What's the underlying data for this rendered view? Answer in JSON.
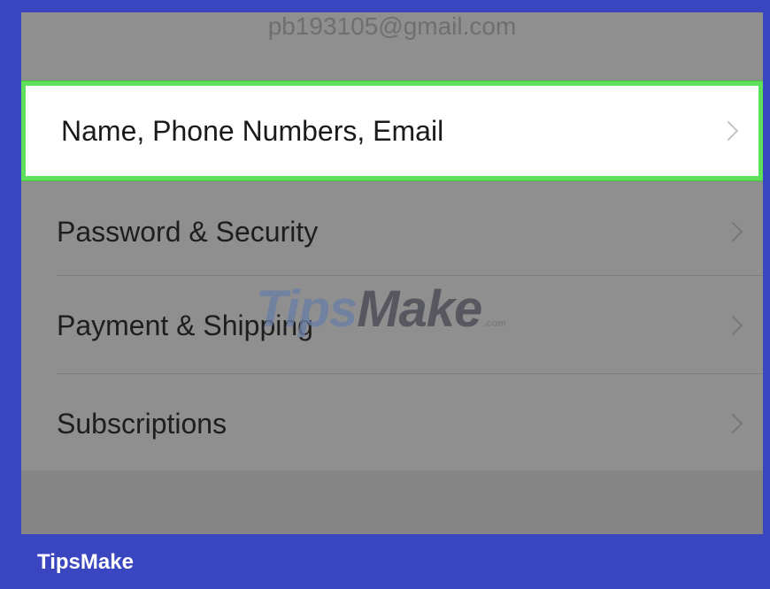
{
  "account": {
    "email": "pb193105@gmail.com"
  },
  "menu": {
    "items": [
      {
        "label": "Name, Phone Numbers, Email",
        "highlighted": true
      },
      {
        "label": "Password & Security",
        "highlighted": false
      },
      {
        "label": "Payment & Shipping",
        "highlighted": false
      },
      {
        "label": "Subscriptions",
        "highlighted": false
      }
    ]
  },
  "watermark": {
    "tips": "Tips",
    "make": "Make",
    "com": ".com"
  },
  "footer": {
    "brand": "TipsMake"
  },
  "colors": {
    "frame": "#3a46c0",
    "highlight_border": "#5ee05a",
    "screen_dim": "#8f8f8f"
  },
  "icons": {
    "row_chevron": "chevron-right-icon"
  }
}
